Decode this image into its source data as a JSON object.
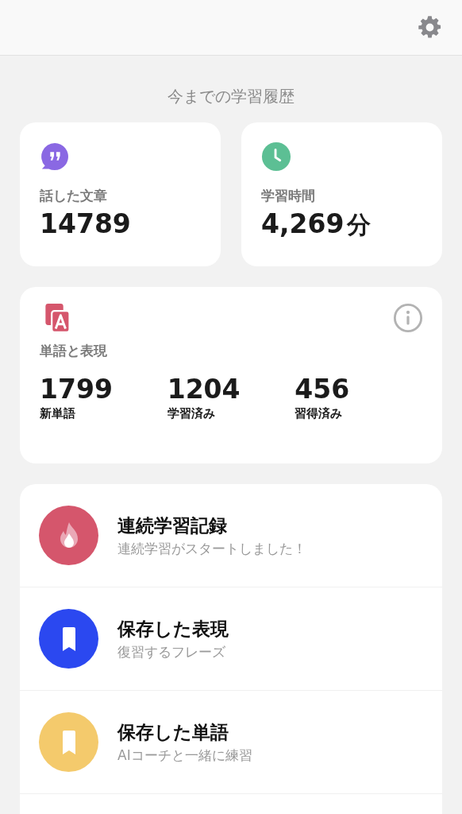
{
  "section_title": "今までの学習履歴",
  "stat_cards": [
    {
      "kind": "quote",
      "label": "話した文章",
      "value": "14789"
    },
    {
      "kind": "clock",
      "label": "学習時間",
      "value": "4,269",
      "unit": "分"
    }
  ],
  "vocab_card": {
    "label": "単語と表現",
    "counts": [
      {
        "value": "1799",
        "label": "新単語"
      },
      {
        "value": "1204",
        "label": "学習済み"
      },
      {
        "value": "456",
        "label": "習得済み"
      }
    ]
  },
  "menu": [
    {
      "kind": "flame",
      "color": "#d5566c",
      "title": "連続学習記録",
      "subtitle": "連続学習がスタートしました！"
    },
    {
      "kind": "bookmark",
      "color": "#2b48f0",
      "title": "保存した表現",
      "subtitle": "復習するフレーズ"
    },
    {
      "kind": "bookmark",
      "color": "#f4ca6c",
      "title": "保存した単語",
      "subtitle": "AIコーチと一緒に練習"
    }
  ]
}
